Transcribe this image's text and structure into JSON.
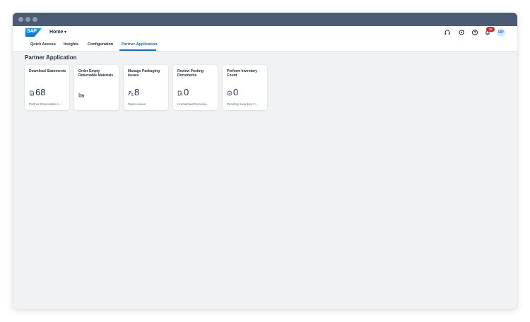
{
  "shell": {
    "logo_text": "SAP",
    "home_label": "Home",
    "notification_count": "39",
    "avatar_initials": "UP"
  },
  "tabs": [
    {
      "label": "Quick Access",
      "active": false
    },
    {
      "label": "Insights",
      "active": false
    },
    {
      "label": "Configuration",
      "active": false
    },
    {
      "label": "Partner Application",
      "active": true
    }
  ],
  "section": {
    "title": "Partner Application"
  },
  "tiles": [
    {
      "title": "Download Statements",
      "icon": "document-chart-icon",
      "value": "68",
      "footer": "Partner Returnable A..."
    },
    {
      "title": "Order Empty Returnable Materials",
      "icon": "factory-icon",
      "value": "",
      "footer": ""
    },
    {
      "title": "Manage Packaging Issues",
      "icon": "person-list-icon",
      "value": "8",
      "footer": "Open issues"
    },
    {
      "title": "Review Posting Documents",
      "icon": "document-search-icon",
      "value": "0",
      "footer": "Unmatched Docume..."
    },
    {
      "title": "Perform Inventory Count",
      "icon": "inventory-check-icon",
      "value": "0",
      "footer": "Pending Inventory C..."
    }
  ],
  "colors": {
    "accent": "#0a6ed1",
    "titlebar": "#4b5c72",
    "background": "#f1f2f4",
    "badge": "#c62b2b"
  }
}
